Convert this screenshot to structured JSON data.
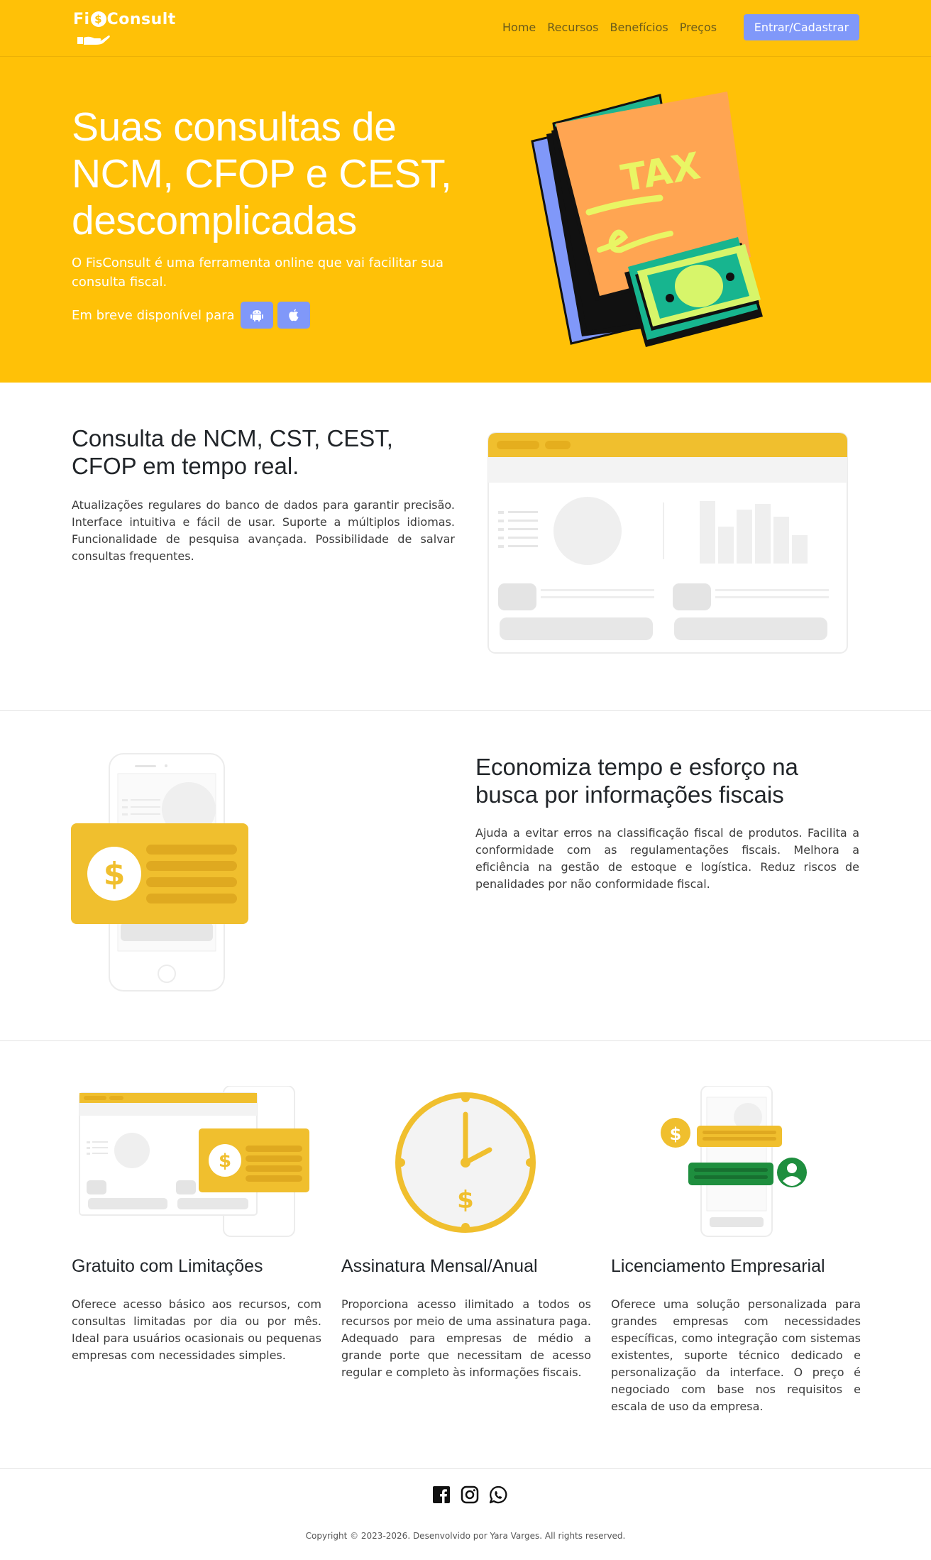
{
  "brand": {
    "name_pre": "Fi",
    "name_coin": "$",
    "name_post": "Consult"
  },
  "nav": {
    "items": [
      "Home",
      "Recursos",
      "Benefícios",
      "Preços"
    ],
    "cta": "Entrar/Cadastrar"
  },
  "hero": {
    "title": "Suas consultas de NCM, CFOP e CEST, descomplicadas",
    "subtitle": "O FisConsult é uma ferramenta online que vai facilitar sua consulta fiscal.",
    "availability": "Em breve disponível para",
    "tax_label": "TAX"
  },
  "section_realtime": {
    "title": "Consulta de NCM, CST, CEST, CFOP em tempo real.",
    "text": "Atualizações regulares do banco de dados para garantir precisão. Interface intuitiva e fácil de usar. Suporte a múltiplos idiomas. Funcionalidade de pesquisa avançada. Possibilidade de salvar consultas frequentes."
  },
  "section_saves": {
    "title": "Economiza tempo e esforço na busca por informações fiscais",
    "text": "Ajuda a evitar erros na classificação fiscal de produtos. Facilita a conformidade com as regulamentações fiscais. Melhora a eficiência na gestão de estoque e logística. Reduz riscos de penalidades por não conformidade fiscal."
  },
  "plans": [
    {
      "title": "Gratuito com Limitações",
      "text": "Oferece acesso básico aos recursos, com consultas limitadas por dia ou por mês. Ideal para usuários ocasionais ou pequenas empresas com necessidades simples."
    },
    {
      "title": "Assinatura Mensal/Anual",
      "text": "Proporciona acesso ilimitado a todos os recursos por meio de uma assinatura paga. Adequado para empresas de médio a grande porte que necessitam de acesso regular e completo às informações fiscais."
    },
    {
      "title": "Licenciamento Empresarial",
      "text": "Oferece uma solução personalizada para grandes empresas com necessidades específicas, como integração com sistemas existentes, suporte técnico dedicado e personalização da interface. O preço é negociado com base nos requisitos e escala de uso da empresa."
    }
  ],
  "footer": {
    "socials": [
      "facebook-icon",
      "instagram-icon",
      "whatsapp-icon"
    ],
    "copyright": "Copyright © 2023-2026. Desenvolvido por Yara Varges. All rights reserved."
  },
  "colors": {
    "primary": "#FFC107",
    "accent": "#8098F9",
    "illustration_yellow": "#F0BF2E",
    "money_green": "#1E8E3E"
  }
}
